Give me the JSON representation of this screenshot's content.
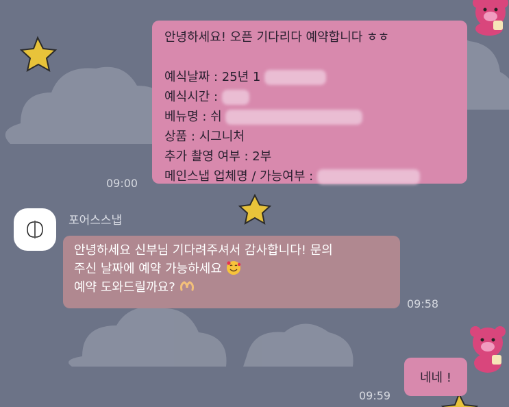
{
  "messages": {
    "outgoing_1": {
      "lines": [
        "안녕하세요! 오픈 기다리다 예약합니다 ㅎㅎ",
        "",
        "예식날짜 : 25년 1",
        "예식시간 :",
        "베뉴명 : 쉬",
        "상품 : 시그니처",
        "추가 촬영 여부 : 2부",
        "메인스냅 업체명 / 가능여부 :"
      ],
      "time": "09:00"
    },
    "incoming_1": {
      "sender": "포어스스냅",
      "lines": [
        "안녕하세요 신부님 기다려주셔서 감사합니다! 문의",
        "주신 날짜에 예약 가능하세요",
        "예약 도와드릴까요?"
      ],
      "time": "09:58",
      "emojis": [
        "smiling-face-with-hearts-icon",
        "heart-hands-icon"
      ]
    },
    "outgoing_2": {
      "text": "네네 !",
      "time": "09:59"
    }
  },
  "colors": {
    "background": "#6c7387",
    "outgoing_bubble": "#d889ad",
    "incoming_bubble": "#b08890",
    "timestamp": "#d6d9e0"
  }
}
